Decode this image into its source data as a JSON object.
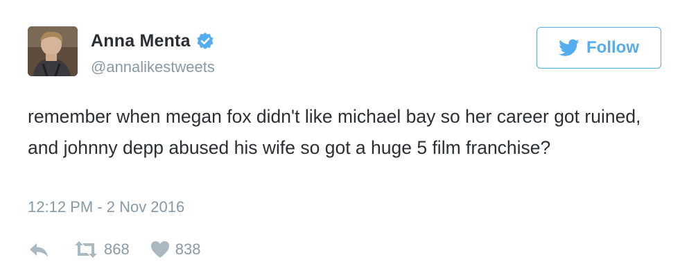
{
  "user": {
    "display_name": "Anna Menta",
    "handle": "@annalikestweets",
    "verified": true
  },
  "follow_button": {
    "label": "Follow",
    "icon": "twitter-bird-icon"
  },
  "tweet": {
    "text": "remember when megan fox didn't like michael bay so her career got ruined, and johnny depp abused his wife so got a huge 5 film franchise?",
    "timestamp": "12:12 PM - 2 Nov 2016"
  },
  "actions": {
    "reply": {
      "icon": "reply-icon"
    },
    "retweet": {
      "icon": "retweet-icon",
      "count": "868"
    },
    "like": {
      "icon": "heart-icon",
      "count": "838"
    }
  },
  "colors": {
    "accent": "#55acee",
    "text": "#292f33",
    "muted": "#8899a6",
    "muted_icon": "#aab8c2"
  }
}
